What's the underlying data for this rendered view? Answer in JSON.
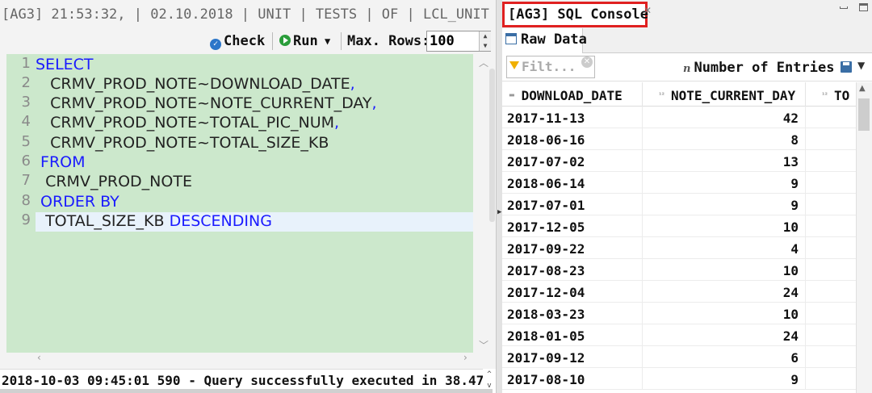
{
  "editor_tab": {
    "title": "[AG3] 21:53:32, | 02.10.2018 | UNIT | TESTS | OF | LCL_UNIT"
  },
  "toolbar": {
    "check_label": "Check",
    "run_label": "Run",
    "max_rows_label": "Max. Rows:",
    "max_rows_value": "100"
  },
  "editor": {
    "line_numbers": [
      "1",
      "2",
      "3",
      "4",
      "5",
      "6",
      "7",
      "8",
      "9"
    ],
    "lines": [
      {
        "text": "SELECT",
        "keyword": true
      },
      {
        "text": "   CRMV_PROD_NOTE~DOWNLOAD_DATE",
        "suffix": ","
      },
      {
        "text": "   CRMV_PROD_NOTE~NOTE_CURRENT_DAY",
        "suffix": ","
      },
      {
        "text": "   CRMV_PROD_NOTE~TOTAL_PIC_NUM",
        "suffix": ","
      },
      {
        "text": "   CRMV_PROD_NOTE~TOTAL_SIZE_KB"
      },
      {
        "text": " FROM",
        "keyword": true
      },
      {
        "text": "  CRMV_PROD_NOTE"
      },
      {
        "text": " ORDER BY",
        "keyword": true
      },
      {
        "text": "  TOTAL_SIZE_KB ",
        "suffix_keyword": "DESCENDING"
      }
    ]
  },
  "status": {
    "message": "2018-10-03 09:45:01 590 - Query successfully executed in 38.47"
  },
  "console": {
    "tab_title": "[AG3] SQL Console",
    "raw_data_tab": "Raw Data",
    "filter_placeholder": "Filt...",
    "entries_label": "Number of Entries",
    "entries_icon": "n",
    "columns": [
      "DOWNLOAD_DATE",
      "NOTE_CURRENT_DAY",
      "TO"
    ],
    "rows": [
      [
        "2017-11-13",
        "42"
      ],
      [
        "2018-06-16",
        "8"
      ],
      [
        "2017-07-02",
        "13"
      ],
      [
        "2018-06-14",
        "9"
      ],
      [
        "2017-07-01",
        "9"
      ],
      [
        "2017-12-05",
        "10"
      ],
      [
        "2017-09-22",
        "4"
      ],
      [
        "2017-08-23",
        "10"
      ],
      [
        "2017-12-04",
        "24"
      ],
      [
        "2018-03-23",
        "10"
      ],
      [
        "2018-01-05",
        "24"
      ],
      [
        "2017-09-12",
        "6"
      ],
      [
        "2017-08-10",
        "9"
      ]
    ]
  },
  "colors": {
    "editor_bg": "#cce8cc",
    "keyword": "#1a1aff",
    "tab_highlight_border": "#e02020",
    "run_icon": "#2a9d3a",
    "check_icon": "#2c76c9"
  }
}
